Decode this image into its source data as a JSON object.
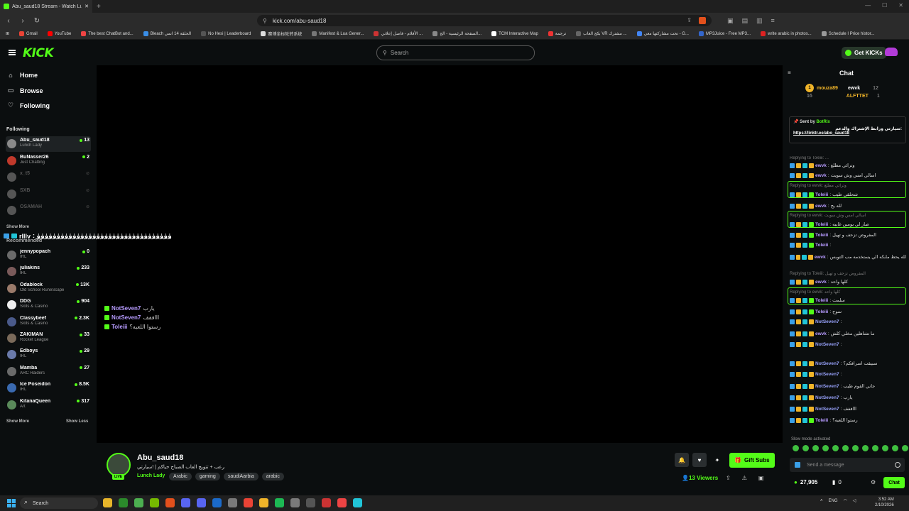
{
  "browser": {
    "tab_title": "Abu_saud18 Stream - Watch Li...",
    "url": "kick.com/abu-saud18",
    "bookmarks": [
      "Gmail",
      "YouTube",
      "The best ChatBot and...",
      "Bleach الحلقة 14 انمي",
      "No Hesi | Leaderboard",
      "赛博坐标轮转系统",
      "Manifest & Lua Gener...",
      "الأفلام - فاصل إعلاني ...",
      "الصفحة الرئيسية - الج...",
      "TCM Interactive Map",
      "ترجمة",
      "بكج العاب VR مشترك ...",
      "تحت مشاركتها معي - G...",
      "MP3Juice - Free MP3...",
      "write arabic in photos...",
      "Schedule I Price histor..."
    ]
  },
  "header": {
    "logo": "KICK",
    "search_placeholder": "Search",
    "get_kicks": "Get KICKs"
  },
  "sidebar": {
    "nav": [
      {
        "label": "Home",
        "icon": "home-icon"
      },
      {
        "label": "Browse",
        "icon": "browse-icon"
      },
      {
        "label": "Following",
        "icon": "heart-icon"
      }
    ],
    "following_title": "Following",
    "following": [
      {
        "name": "Abu_saud18",
        "category": "Lunch Lady",
        "viewers": "13"
      },
      {
        "name": "BuNasser26",
        "category": "Just Chatting",
        "viewers": "2"
      },
      {
        "name": "x_t5",
        "category": "",
        "viewers": "off"
      },
      {
        "name": "SXB",
        "category": "",
        "viewers": "off"
      },
      {
        "name": "OSAMAH",
        "category": "",
        "viewers": "off"
      }
    ],
    "show_more_1": "Show More",
    "recommended_title": "Recommended",
    "recommended": [
      {
        "name": "jennypopach",
        "category": "IRL",
        "viewers": "0"
      },
      {
        "name": "juliakins",
        "category": "IRL",
        "viewers": "233"
      },
      {
        "name": "Odablock",
        "category": "Old School RuneScape",
        "viewers": "13K"
      },
      {
        "name": "DDG",
        "category": "Slots & Casino",
        "viewers": "904"
      },
      {
        "name": "Classybeef",
        "category": "Slots & Casino",
        "viewers": "2.3K"
      },
      {
        "name": "ZAKIMAN",
        "category": "Rocket League",
        "viewers": "33"
      },
      {
        "name": "Edboys",
        "category": "IRL",
        "viewers": "29"
      },
      {
        "name": "Mamba",
        "category": "ARC Raiders",
        "viewers": "27"
      },
      {
        "name": "Ice Poseidon",
        "category": "IRL",
        "viewers": "8.5K"
      },
      {
        "name": "KitanaQueen",
        "category": "Art",
        "viewers": "317"
      }
    ],
    "show_more_2": "Show More",
    "show_less": "Show Less"
  },
  "player": {
    "overlay_user": "rlllv",
    "overlay_text": ": ﯛﯛﯛﯛﯛﯛﯛﯛﯛﯛﯛﯛﯛﯛﯛﯛﯛﯛﯛﯛﯛﯛﯛﯛﯛﯛﯛﯛﯛﯛﯛﯛﯛﯛ",
    "overlay_chat": [
      {
        "user": "NotSeven7",
        "text": "يارب"
      },
      {
        "user": "NotSeven7",
        "text": "اااففف"
      },
      {
        "user": "Toleiii",
        "text": "رستوا اللعبه؟"
      }
    ]
  },
  "stream": {
    "name": "Abu_saud18",
    "title": "رعب + تتويج العاب الصباح حياكم | !سيارتي",
    "live": "LIVE",
    "category": "Lunch Lady",
    "tags": [
      "Arabic",
      "gaming",
      "saudiAarbia",
      "arabic"
    ],
    "gift_subs": "Gift Subs",
    "viewers": "13 Viewers"
  },
  "chat": {
    "title": "Chat",
    "leaderboard": {
      "user1": "mouza89",
      "count1": "16",
      "user2": "ewvk",
      "count2": "12",
      "user3": "ALFTTET",
      "count3": "1"
    },
    "pinned": {
      "sent_by": "Sent by",
      "bot": "BotRix",
      "message": "سيارتي ورابط الإشتراك والدعم:",
      "link": "https://linktr.ee/abo_saud18"
    },
    "messages": [
      {
        "type": "reply",
        "text": "Replying to Toleiii: ..."
      },
      {
        "type": "msg",
        "user": "ewvk",
        "text": "وترائي مطلع",
        "cls": "ewvk"
      },
      {
        "type": "msg",
        "user": "ewvk",
        "text": "اسالي امس وش سويت",
        "cls": "ewvk"
      },
      {
        "type": "reply",
        "text": "Replying to ewvk: وترائي مطلع"
      },
      {
        "type": "msg",
        "user": "Toleiii",
        "text": "شحلقي طيب",
        "cls": "tol"
      },
      {
        "type": "msg",
        "user": "ewvk",
        "text": "لله يح",
        "cls": "ewvk"
      },
      {
        "type": "reply",
        "text": "Replying to ewvk: اسالي امس وش سويت"
      },
      {
        "type": "msg",
        "user": "Toleiii",
        "text": "صار لي يومين غايبه",
        "cls": "tol"
      },
      {
        "type": "msg",
        "user": "Toleiii",
        "text": "المفروض تزحف و تهيل",
        "cls": "tol"
      },
      {
        "type": "msg",
        "user": "Toleiii",
        "text": "",
        "cls": "tol"
      },
      {
        "type": "msg",
        "user": "ewvk",
        "text": "لله يحط مابكه الي يستخدمه مب التوبس",
        "cls": "ewvk"
      },
      {
        "type": "reply",
        "text": "Replying to Toleiii: المفروض تزحف و تهيل"
      },
      {
        "type": "msg",
        "user": "ewvk",
        "text": "كلها واحد",
        "cls": "ewvk"
      },
      {
        "type": "reply",
        "text": "Replying to ewvk: كلها واحد"
      },
      {
        "type": "msg",
        "user": "Toleiii",
        "text": "سلمت",
        "cls": "tol"
      },
      {
        "type": "msg",
        "user": "Toleiii",
        "text": "سوح",
        "cls": "tol"
      },
      {
        "type": "msg",
        "user": "NotSeven7",
        "text": "",
        "cls": "ns"
      },
      {
        "type": "msg",
        "user": "ewvk",
        "text": "ما تشاهلين مخلي كلش",
        "cls": "ewvk"
      },
      {
        "type": "msg",
        "user": "NotSeven7",
        "text": "",
        "cls": "ns"
      },
      {
        "type": "msg",
        "user": "NotSeven7",
        "text": "سبيقت اسرافكم؟",
        "cls": "ns"
      },
      {
        "type": "msg",
        "user": "NotSeven7",
        "text": "",
        "cls": "ns"
      },
      {
        "type": "msg",
        "user": "NotSeven7",
        "text": "جاني القوم طيب",
        "cls": "ns"
      },
      {
        "type": "msg",
        "user": "NotSeven7",
        "text": "يارب",
        "cls": "ns"
      },
      {
        "type": "msg",
        "user": "NotSeven7",
        "text": "اااففف",
        "cls": "ns"
      },
      {
        "type": "msg",
        "user": "Toleiii",
        "text": "رستوا اللعبه؟",
        "cls": "tol"
      }
    ],
    "slow_mode": "Slow mode activated",
    "send_placeholder": "Send a message",
    "kicks": "27,905",
    "zero": "0",
    "chat_button": "Chat"
  },
  "taskbar": {
    "search": "Search",
    "lang": "ENG",
    "time": "3:52 AM",
    "date": "2/10/2026"
  }
}
